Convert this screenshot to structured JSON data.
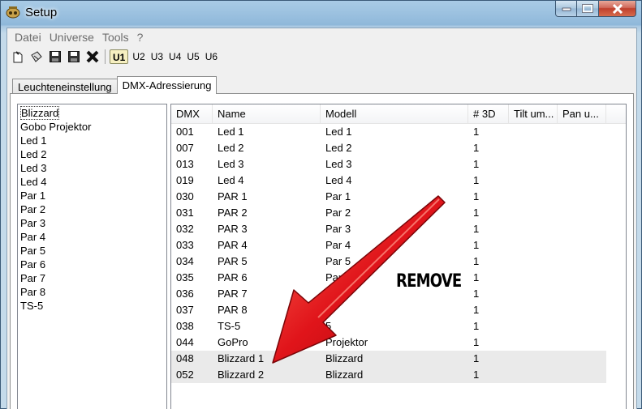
{
  "window": {
    "title": "Setup"
  },
  "menu": [
    "Datei",
    "Universe",
    "Tools",
    "?"
  ],
  "toolbar": {
    "universes": [
      "U1",
      "U2",
      "U3",
      "U4",
      "U5",
      "U6"
    ],
    "active_universe": "U1"
  },
  "tabs": [
    {
      "label": "Leuchteneinstellung",
      "active": false
    },
    {
      "label": "DMX-Adressierung",
      "active": true
    }
  ],
  "fixture_list": [
    "Blizzard",
    "Gobo Projektor",
    "Led 1",
    "Led 2",
    "Led 3",
    "Led 4",
    "Par 1",
    "Par 2",
    "Par 3",
    "Par 4",
    "Par 5",
    "Par 6",
    "Par 7",
    "Par 8",
    "TS-5"
  ],
  "table": {
    "headers": [
      "DMX",
      "Name",
      "Modell",
      "# 3D",
      "Tilt um...",
      "Pan u..."
    ],
    "rows": [
      [
        "001",
        "Led 1",
        "Led 1",
        "1"
      ],
      [
        "007",
        "Led 2",
        "Led 2",
        "1"
      ],
      [
        "013",
        "Led 3",
        "Led 3",
        "1"
      ],
      [
        "019",
        "Led 4",
        "Led 4",
        "1"
      ],
      [
        "030",
        "PAR 1",
        "Par 1",
        "1"
      ],
      [
        "031",
        "PAR 2",
        "Par 2",
        "1"
      ],
      [
        "032",
        "PAR 3",
        "Par 3",
        "1"
      ],
      [
        "033",
        "PAR 4",
        "Par 4",
        "1"
      ],
      [
        "034",
        "PAR 5",
        "Par 5",
        "1"
      ],
      [
        "035",
        "PAR 6",
        "Par 6",
        "1"
      ],
      [
        "036",
        "PAR 7",
        "P",
        "1"
      ],
      [
        "037",
        "PAR 8",
        "3",
        "1"
      ],
      [
        "038",
        "TS-5",
        "5",
        "1"
      ],
      [
        "044",
        "GoPro",
        "Projektor",
        "1"
      ],
      [
        "048",
        "Blizzard 1",
        "Blizzard",
        "1"
      ],
      [
        "052",
        "Blizzard 2",
        "Blizzard",
        "1"
      ]
    ],
    "highlighted_rows": [
      14,
      15
    ]
  },
  "annotation": {
    "label": "REMOVE",
    "arrow_color": "#e0141a"
  }
}
